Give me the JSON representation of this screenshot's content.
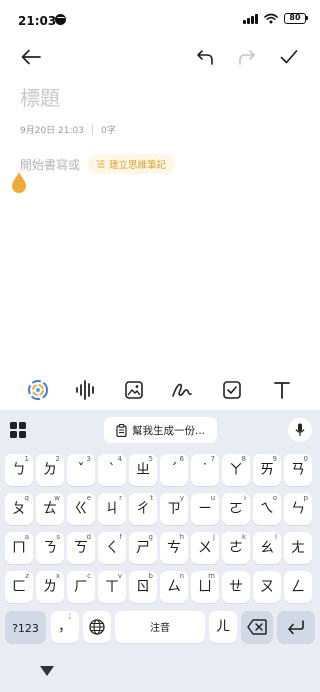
{
  "status_bar": {
    "time": "21:03",
    "battery": "80"
  },
  "editor": {
    "title_placeholder": "標題",
    "date": "9月20日 21:03",
    "char_count": "0字",
    "body_placeholder": "開始書寫或",
    "mindmap_label": "建立思維筆記",
    "accent_color": "#f2a93b"
  },
  "format_bar": {
    "items": [
      "ai-assistant-icon",
      "voice-wave-icon",
      "image-icon",
      "handwriting-icon",
      "checklist-icon",
      "text-format-icon"
    ]
  },
  "keyboard": {
    "ai_suggestion": "幫我生成一份...",
    "row1": [
      {
        "main": "ㄅ",
        "sub": "1"
      },
      {
        "main": "ㄉ",
        "sub": "2"
      },
      {
        "main": "ˇ",
        "sub": "3"
      },
      {
        "main": "ˋ",
        "sub": "4"
      },
      {
        "main": "ㄓ",
        "sub": "5"
      },
      {
        "main": "ˊ",
        "sub": "6"
      },
      {
        "main": "˙",
        "sub": "7"
      },
      {
        "main": "ㄚ",
        "sub": "8"
      },
      {
        "main": "ㄞ",
        "sub": "9"
      },
      {
        "main": "ㄢ",
        "sub": "0"
      }
    ],
    "row2": [
      {
        "main": "ㄆ",
        "sub": "q"
      },
      {
        "main": "ㄊ",
        "sub": "w"
      },
      {
        "main": "ㄍ",
        "sub": "e"
      },
      {
        "main": "ㄐ",
        "sub": "r"
      },
      {
        "main": "ㄔ",
        "sub": "t"
      },
      {
        "main": "ㄗ",
        "sub": "y"
      },
      {
        "main": "ㄧ",
        "sub": "u"
      },
      {
        "main": "ㄛ",
        "sub": "i"
      },
      {
        "main": "ㄟ",
        "sub": "o"
      },
      {
        "main": "ㄣ",
        "sub": "p"
      }
    ],
    "row3": [
      {
        "main": "ㄇ",
        "sub": "a"
      },
      {
        "main": "ㄋ",
        "sub": "s"
      },
      {
        "main": "ㄎ",
        "sub": "d"
      },
      {
        "main": "ㄑ",
        "sub": "f"
      },
      {
        "main": "ㄕ",
        "sub": "g"
      },
      {
        "main": "ㄘ",
        "sub": "h"
      },
      {
        "main": "ㄨ",
        "sub": "j"
      },
      {
        "main": "ㄜ",
        "sub": "k"
      },
      {
        "main": "ㄠ",
        "sub": "l"
      },
      {
        "main": "ㄤ",
        "sub": ""
      }
    ],
    "row4": [
      {
        "main": "ㄈ",
        "sub": "z"
      },
      {
        "main": "ㄌ",
        "sub": "x"
      },
      {
        "main": "ㄏ",
        "sub": "c"
      },
      {
        "main": "ㄒ",
        "sub": "v"
      },
      {
        "main": "ㄖ",
        "sub": "b"
      },
      {
        "main": "ㄙ",
        "sub": "n"
      },
      {
        "main": "ㄩ",
        "sub": "m"
      },
      {
        "main": "ㄝ",
        "sub": ""
      },
      {
        "main": "ㄡ",
        "sub": ""
      },
      {
        "main": "ㄥ",
        "sub": ""
      }
    ],
    "bottom": {
      "symbols": "?123",
      "comma": "，",
      "comma_sub": "；",
      "space": "注音",
      "er": "ㄦ"
    }
  }
}
